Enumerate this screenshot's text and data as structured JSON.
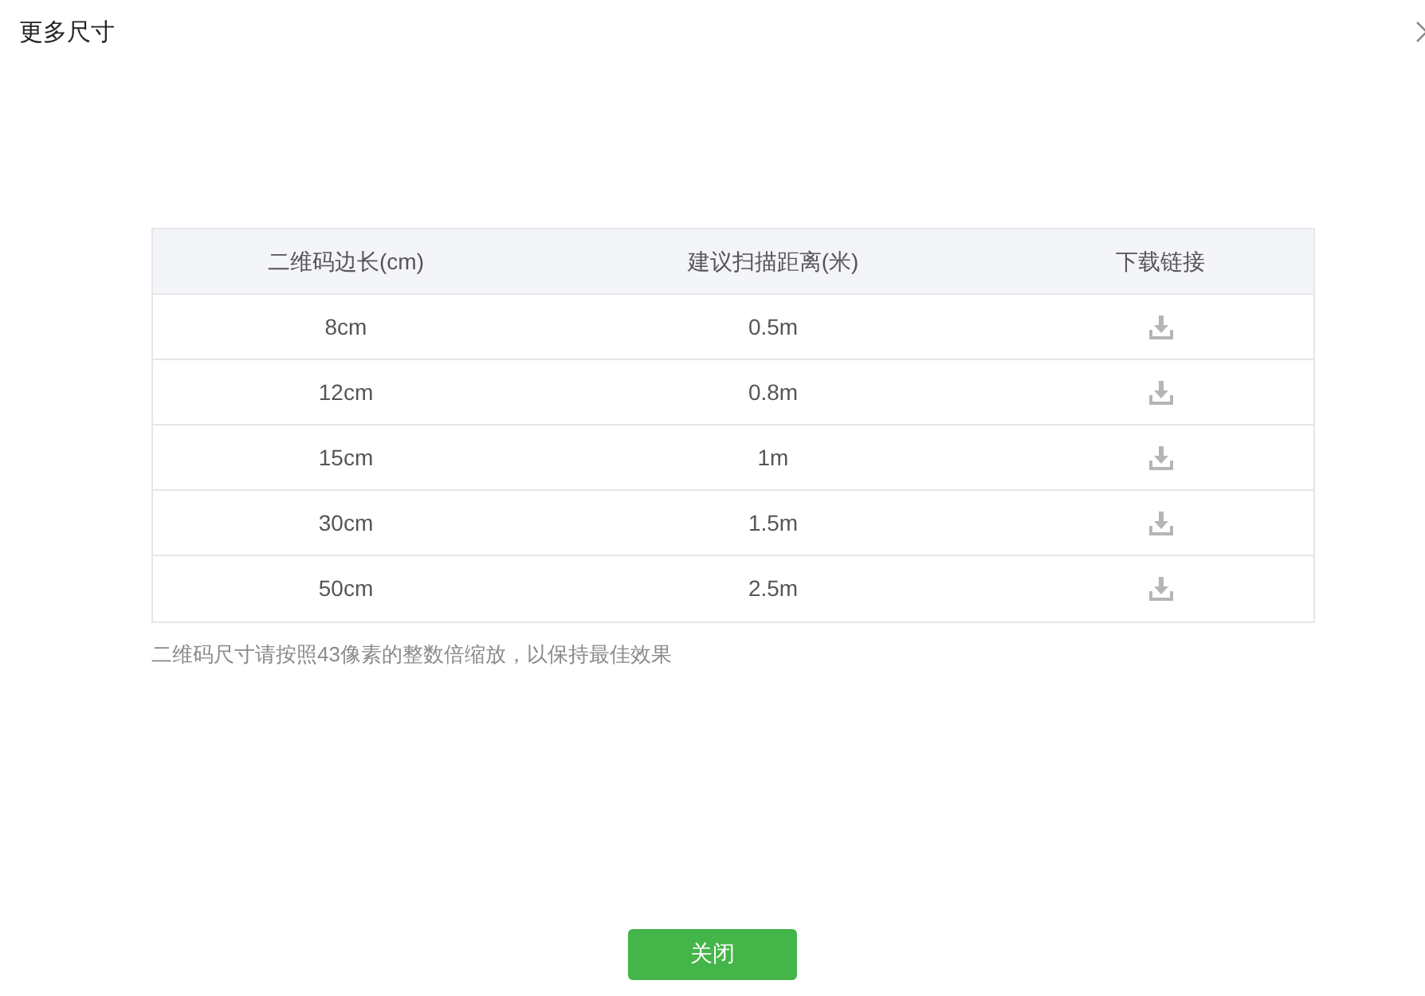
{
  "dialog": {
    "title": "更多尺寸"
  },
  "table": {
    "columns": [
      "二维码边长(cm)",
      "建议扫描距离(米)",
      "下载链接"
    ],
    "rows": [
      {
        "size": "8cm",
        "distance": "0.5m"
      },
      {
        "size": "12cm",
        "distance": "0.8m"
      },
      {
        "size": "15cm",
        "distance": "1m"
      },
      {
        "size": "30cm",
        "distance": "1.5m"
      },
      {
        "size": "50cm",
        "distance": "2.5m"
      }
    ]
  },
  "note": "二维码尺寸请按照43像素的整数倍缩放，以保持最佳效果",
  "buttons": [
    "关闭"
  ]
}
